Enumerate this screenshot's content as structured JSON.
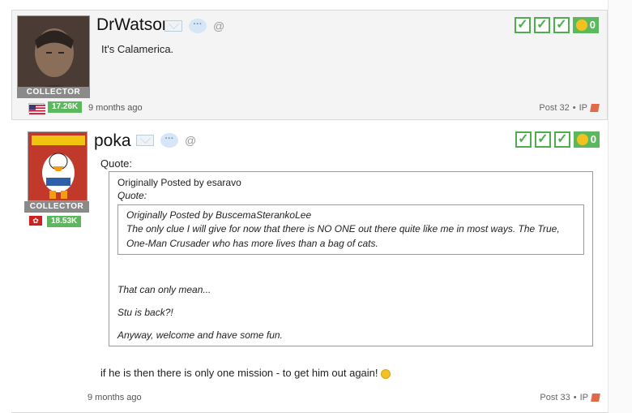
{
  "posts": [
    {
      "username": "DrWatson",
      "rank": "COLLECTOR",
      "score": "17.26K",
      "body": "It's Calamerica.",
      "date": "9 months ago",
      "post_number": "Post 32",
      "ip_label": "IP",
      "reaction_count": "0"
    },
    {
      "username": "poka",
      "rank": "COLLECTOR",
      "score": "18.53K",
      "quote_label": "Quote:",
      "quote_byline": "Originally Posted by esaravo",
      "nested_quote_label": "Quote:",
      "nested_byline": "Originally Posted by BuscemaSterankoLee",
      "nested_text": "The only clue I will give for now that there is NO ONE out there quite like me in most ways. The True, One-Man Crusader who has more lives than a bag of cats.",
      "quote_lines": [
        "That can only mean...",
        "Stu is back?!",
        "Anyway, welcome and have some fun."
      ],
      "reply": "if he is then there is only one mission - to get him out again!",
      "date": "9 months ago",
      "post_number": "Post 33",
      "ip_label": "IP",
      "reaction_count": "0"
    }
  ],
  "colors": {
    "accent_green": "#5cb85c",
    "rank_gray": "#8a8a8a"
  }
}
